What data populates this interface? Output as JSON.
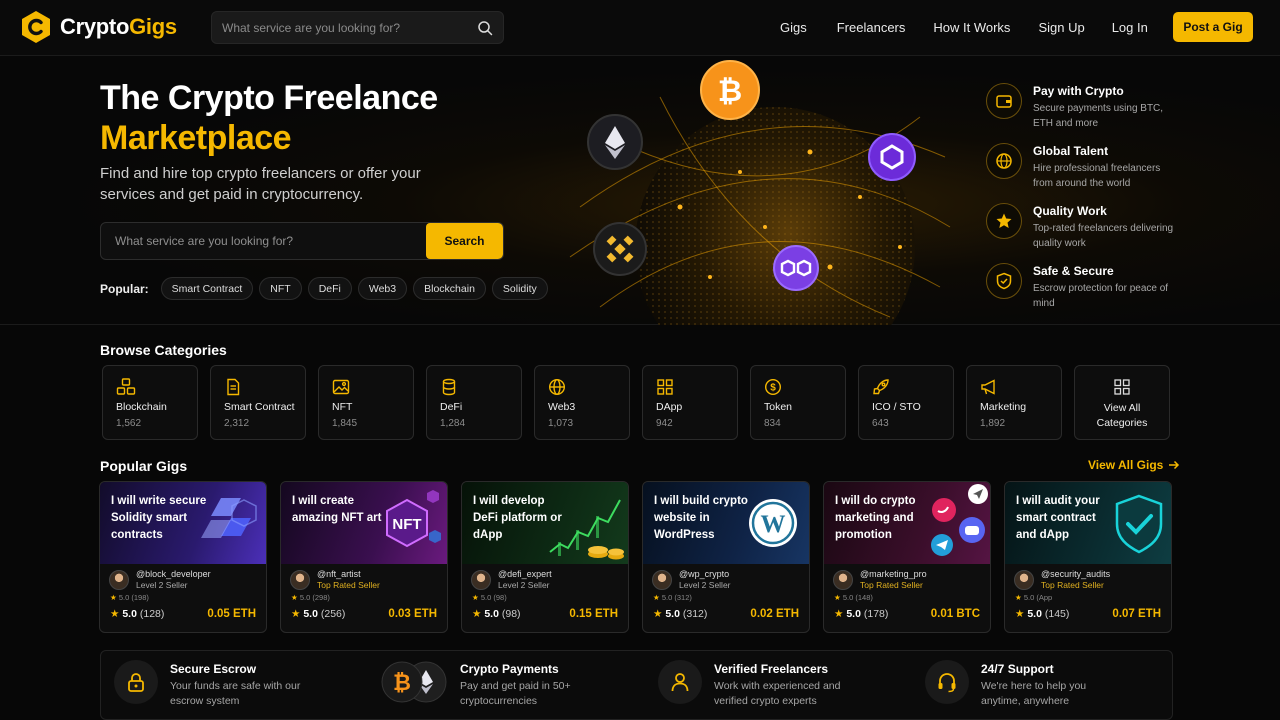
{
  "brand": {
    "name_part1": "Crypto",
    "name_part2": "Gigs"
  },
  "nav": {
    "search_placeholder": "What service are you looking for?",
    "links": [
      "Gigs",
      "Freelancers",
      "How It Works",
      "Sign Up",
      "Log In"
    ],
    "cta": "Post a Gig"
  },
  "hero": {
    "title_line1": "The Crypto Freelance",
    "title_line2": "Marketplace",
    "subtitle": "Find and hire top crypto freelancers or offer your services and get paid in cryptocurrency.",
    "search_placeholder": "What service are you looking for?",
    "search_button": "Search",
    "popular_label": "Popular:",
    "popular_tags": [
      "Smart Contract",
      "NFT",
      "DeFi",
      "Web3",
      "Blockchain",
      "Solidity"
    ]
  },
  "features": [
    {
      "icon": "wallet-icon",
      "title": "Pay with Crypto",
      "desc": "Secure payments using BTC, ETH and more"
    },
    {
      "icon": "globe-icon",
      "title": "Global Talent",
      "desc": "Hire professional freelancers from around the world"
    },
    {
      "icon": "star-icon",
      "title": "Quality Work",
      "desc": "Top-rated freelancers delivering quality work"
    },
    {
      "icon": "shield-icon",
      "title": "Safe & Secure",
      "desc": "Escrow protection for peace of mind"
    }
  ],
  "categories": {
    "title": "Browse Categories",
    "items": [
      {
        "icon": "blockchain-icon",
        "name": "Blockchain",
        "count": "1,562"
      },
      {
        "icon": "contract-icon",
        "name": "Smart Contract",
        "count": "2,312"
      },
      {
        "icon": "image-icon",
        "name": "NFT",
        "count": "1,845"
      },
      {
        "icon": "database-icon",
        "name": "DeFi",
        "count": "1,284"
      },
      {
        "icon": "globe-icon",
        "name": "Web3",
        "count": "1,073"
      },
      {
        "icon": "grid-icon",
        "name": "DApp",
        "count": "942"
      },
      {
        "icon": "coin-icon",
        "name": "Token",
        "count": "834"
      },
      {
        "icon": "rocket-icon",
        "name": "ICO / STO",
        "count": "643"
      },
      {
        "icon": "megaphone-icon",
        "name": "Marketing",
        "count": "1,892"
      }
    ],
    "view_all_line1": "View All",
    "view_all_line2": "Categories"
  },
  "gigs": {
    "title": "Popular Gigs",
    "view_all": "View All Gigs",
    "items": [
      {
        "title": "I will write secure Solidity smart contracts",
        "seller": "@block_developer",
        "level": "Level 2 Seller",
        "small_rating": "5.0",
        "small_count": "(198)",
        "rating": "5.0",
        "reviews": "(128)",
        "price": "0.05 ETH",
        "art": "solidity"
      },
      {
        "title": "I will create amazing NFT art",
        "seller": "@nft_artist",
        "level": "Top Rated Seller",
        "small_rating": "5.0",
        "small_count": "(298)",
        "rating": "5.0",
        "reviews": "(256)",
        "price": "0.03 ETH",
        "art": "nft"
      },
      {
        "title": "I will develop DeFi platform or dApp",
        "seller": "@defi_expert",
        "level": "Level 2 Seller",
        "small_rating": "5.0",
        "small_count": "(98)",
        "rating": "5.0",
        "reviews": "(98)",
        "price": "0.15 ETH",
        "art": "defi"
      },
      {
        "title": "I will build crypto website in WordPress",
        "seller": "@wp_crypto",
        "level": "Level 2 Seller",
        "small_rating": "5.0",
        "small_count": "(312)",
        "rating": "5.0",
        "reviews": "(312)",
        "price": "0.02 ETH",
        "art": "wordpress"
      },
      {
        "title": "I will do crypto marketing and promotion",
        "seller": "@marketing_pro",
        "level": "Top Rated Seller",
        "small_rating": "5.0",
        "small_count": "(148)",
        "rating": "5.0",
        "reviews": "(178)",
        "price": "0.01 BTC",
        "art": "marketing"
      },
      {
        "title": "I will audit your smart contract and dApp",
        "seller": "@security_audits",
        "level": "Top Rated Seller",
        "small_rating": "5.0",
        "small_count": "(App",
        "rating": "5.0",
        "reviews": "(145)",
        "price": "0.07 ETH",
        "art": "audit"
      }
    ]
  },
  "trust": [
    {
      "icon": "lock-icon",
      "title": "Secure Escrow",
      "desc": "Your funds are safe with our escrow system"
    },
    {
      "icon": "crypto-coins-icon",
      "title": "Crypto Payments",
      "desc": "Pay and get paid in 50+ cryptocurrencies"
    },
    {
      "icon": "user-icon",
      "title": "Verified Freelancers",
      "desc": "Work with experienced and verified crypto experts"
    },
    {
      "icon": "headset-icon",
      "title": "24/7 Support",
      "desc": "We're here to help you anytime, anywhere"
    }
  ],
  "colors": {
    "accent": "#f5b800",
    "background": "#070707",
    "card": "#0e0e0e"
  }
}
